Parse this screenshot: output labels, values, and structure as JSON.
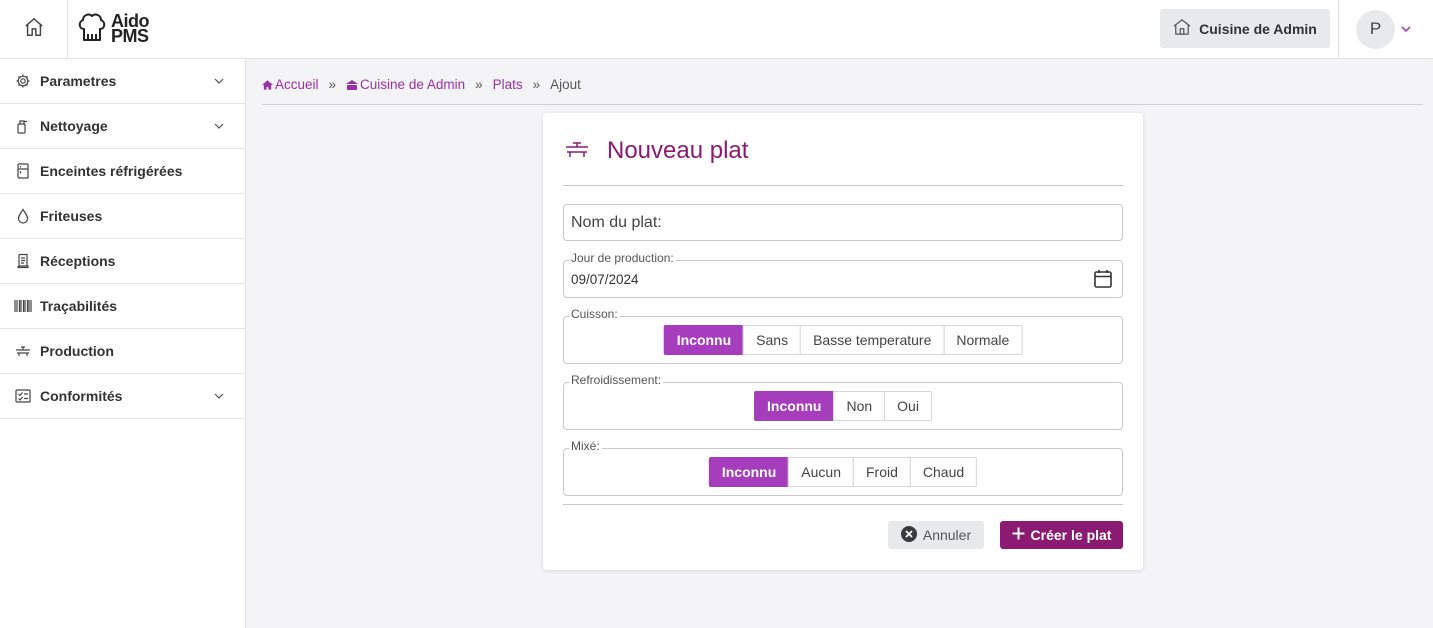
{
  "header": {
    "logo_line1": "Aido",
    "logo_line2": "PMS",
    "kitchen_label": "Cuisine de Admin",
    "user_initial": "P"
  },
  "sidebar": {
    "items": [
      {
        "label": "Parametres",
        "icon": "gear-icon",
        "has_chevron": true
      },
      {
        "label": "Nettoyage",
        "icon": "spray-bottle-icon",
        "has_chevron": true
      },
      {
        "label": "Enceintes réfrigérées",
        "icon": "fridge-icon",
        "has_chevron": false
      },
      {
        "label": "Friteuses",
        "icon": "oil-drop-icon",
        "has_chevron": false
      },
      {
        "label": "Réceptions",
        "icon": "receipt-icon",
        "has_chevron": false
      },
      {
        "label": "Traçabilités",
        "icon": "barcode-icon",
        "has_chevron": false
      },
      {
        "label": "Production",
        "icon": "dish-icon",
        "has_chevron": false
      },
      {
        "label": "Conformités",
        "icon": "checklist-icon",
        "has_chevron": true
      }
    ]
  },
  "breadcrumb": {
    "items": [
      "Accueil",
      "Cuisine de Admin",
      "Plats"
    ],
    "current": "Ajout",
    "separator": "»"
  },
  "form": {
    "title": "Nouveau plat",
    "name_placeholder": "Nom du plat:",
    "date_label": "Jour de production:",
    "date_value": "09/07/2024",
    "cuisson": {
      "label": "Cuisson:",
      "options": [
        "Inconnu",
        "Sans",
        "Basse temperature",
        "Normale"
      ],
      "selected": "Inconnu"
    },
    "refroidissement": {
      "label": "Refroidissement:",
      "options": [
        "Inconnu",
        "Non",
        "Oui"
      ],
      "selected": "Inconnu"
    },
    "mixe": {
      "label": "Mixé:",
      "options": [
        "Inconnu",
        "Aucun",
        "Froid",
        "Chaud"
      ],
      "selected": "Inconnu"
    },
    "cancel_label": "Annuler",
    "create_label": "Créer le plat"
  },
  "colors": {
    "brand": "#8a1a72",
    "accent": "#a63dbd",
    "link": "#9c2fa8"
  }
}
